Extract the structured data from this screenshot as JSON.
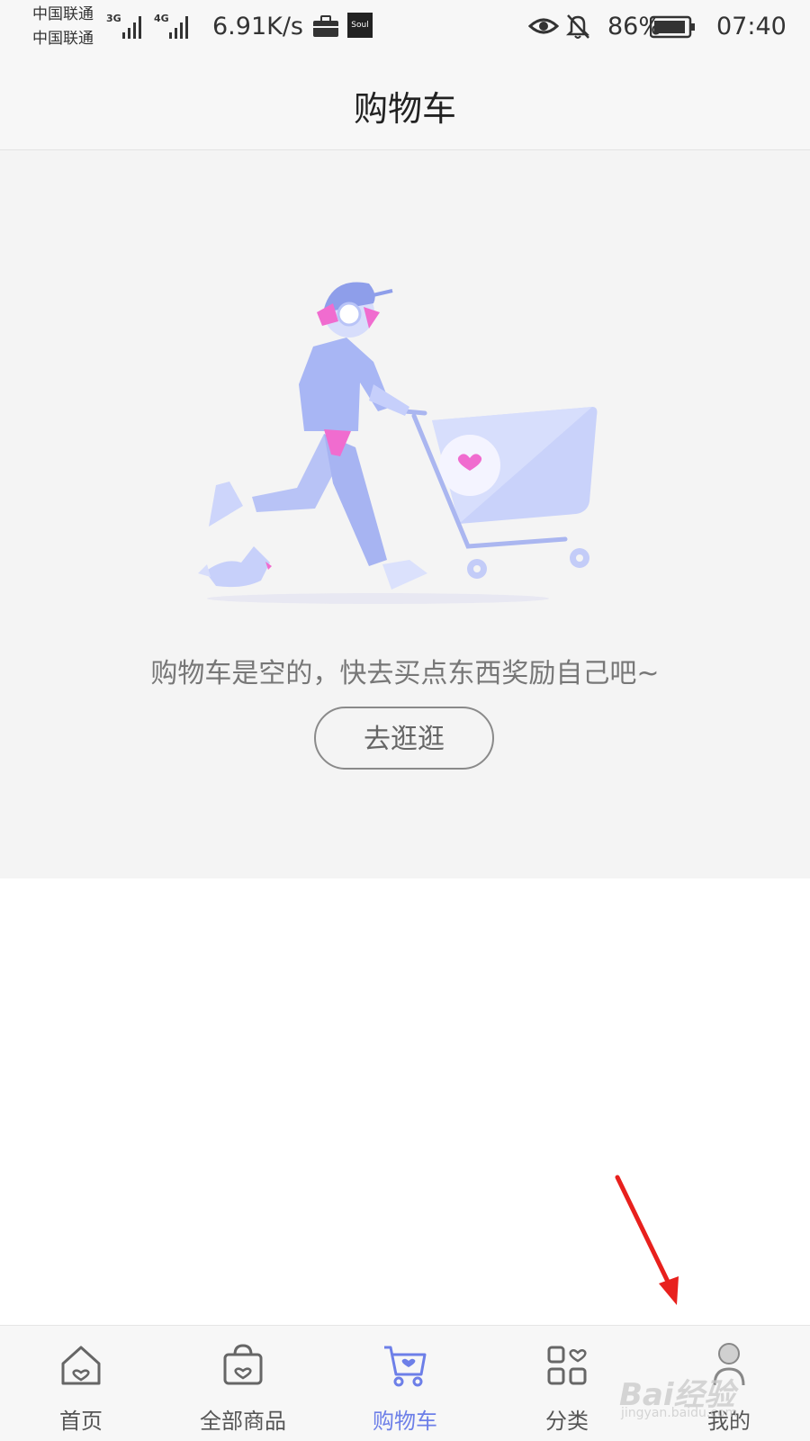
{
  "status_bar": {
    "carrier_1": "中国联通",
    "carrier_2": "中国联通",
    "net_type_1": "3G",
    "net_type_2": "4G",
    "net_speed": "6.91K/s",
    "battery_percent": "86%",
    "time": "07:40",
    "icons": [
      "signal-icon",
      "briefcase-icon",
      "soul-app-icon",
      "eye-icon",
      "bell-off-icon",
      "battery-icon"
    ],
    "soul_app_label": "Soul"
  },
  "header": {
    "title": "购物车"
  },
  "empty_state": {
    "message": "购物车是空的，快去买点东西奖励自己吧~",
    "button_label": "去逛逛",
    "illustration": "person-pushing-cart-illustration"
  },
  "tab_bar": {
    "active_index": 2,
    "active_color": "#6d7fe8",
    "tabs": [
      {
        "label": "首页",
        "icon": "home-heart-icon"
      },
      {
        "label": "全部商品",
        "icon": "bag-heart-icon"
      },
      {
        "label": "购物车",
        "icon": "cart-heart-icon"
      },
      {
        "label": "分类",
        "icon": "grid-heart-icon"
      },
      {
        "label": "我的",
        "icon": "person-icon"
      }
    ]
  },
  "watermark": {
    "text": "Bai经验",
    "sub": "jingyan.baidu.com"
  }
}
